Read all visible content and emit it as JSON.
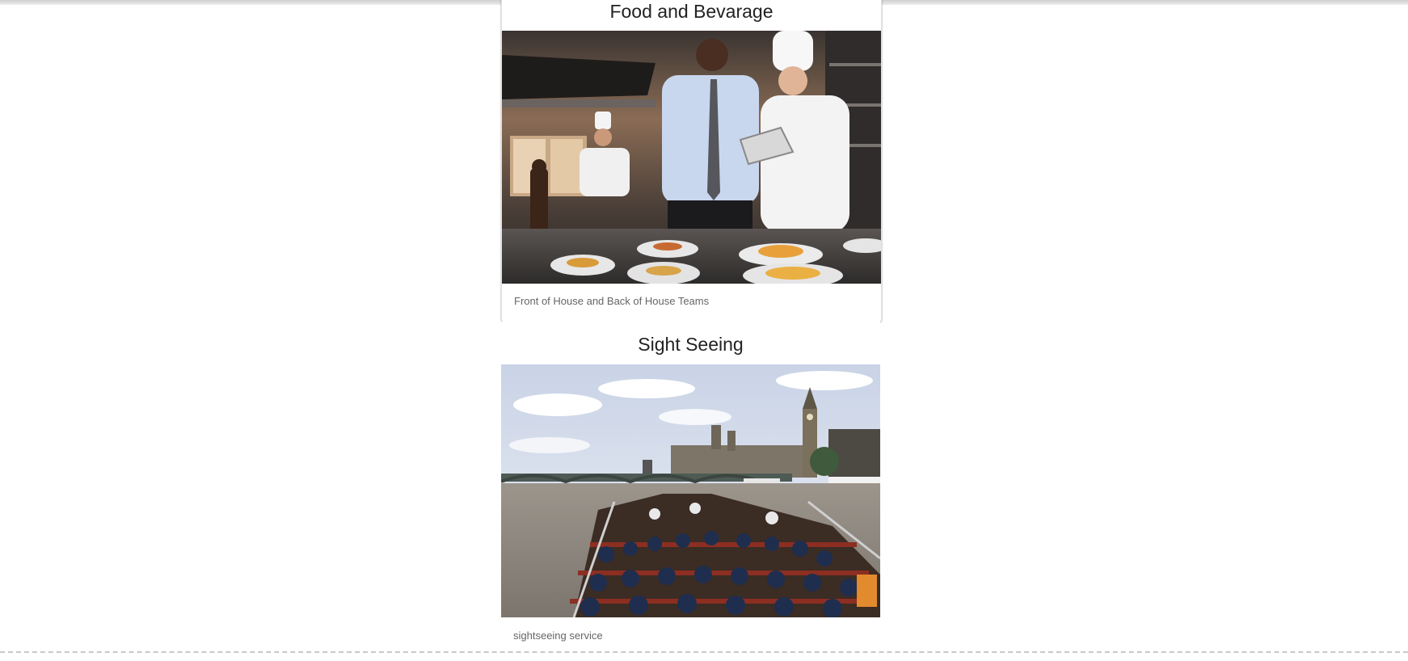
{
  "cards": [
    {
      "title": "Food and Bevarage",
      "caption": "Front of House and Back of House Teams",
      "image_alt": "Restaurant staff and chefs reviewing a tablet in a kitchen"
    },
    {
      "title": "Sight Seeing",
      "caption": "sightseeing service",
      "image_alt": "Tourists on an open-top river boat approaching Big Ben and the Houses of Parliament"
    }
  ]
}
